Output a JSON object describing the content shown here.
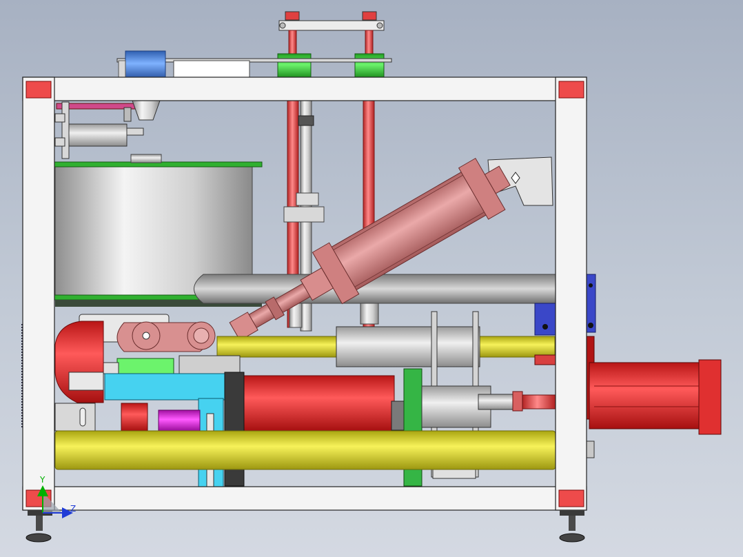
{
  "triad": {
    "y_label": "Y",
    "z_label": "Z",
    "y_color": "#00b000",
    "z_color": "#1f3bd6"
  },
  "palette": {
    "frame": "#f4f4f4",
    "corner_block": "#ee4b4b",
    "cylinder": "#d98c8c",
    "yellow_pipe": "#e8e020",
    "red_motor": "#ee2a2a",
    "cyan_block": "#46d2f0",
    "blue_bracket": "#3a47c8",
    "green_gear": "#35b545",
    "magenta_rod": "#e020e0",
    "steel": "#c8c8c8"
  }
}
